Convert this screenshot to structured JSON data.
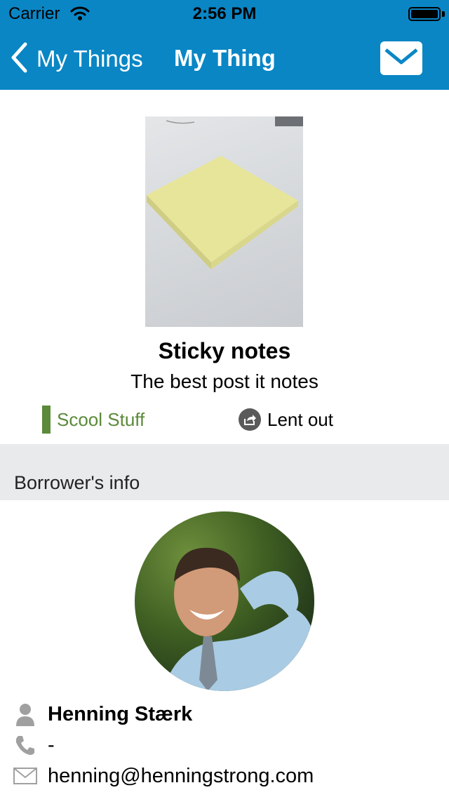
{
  "status_bar": {
    "carrier": "Carrier",
    "time": "2:56 PM",
    "wifi_icon": "wifi-icon",
    "battery_icon": "battery-icon"
  },
  "nav": {
    "back_label": "My Things",
    "title": "My Thing",
    "mail_icon": "envelope-icon",
    "background_color": "#0a86c5"
  },
  "item": {
    "name": "Sticky notes",
    "description": "The best post it notes",
    "category": "Scool Stuff",
    "category_color": "#5b8a3a",
    "status": "Lent out",
    "status_icon": "share-icon"
  },
  "borrower": {
    "section_title": "Borrower's info",
    "name": "Henning Stærk",
    "phone": "-",
    "email": "henning@henningstrong.com",
    "icons": [
      "person-icon",
      "phone-icon",
      "envelope-icon"
    ]
  }
}
